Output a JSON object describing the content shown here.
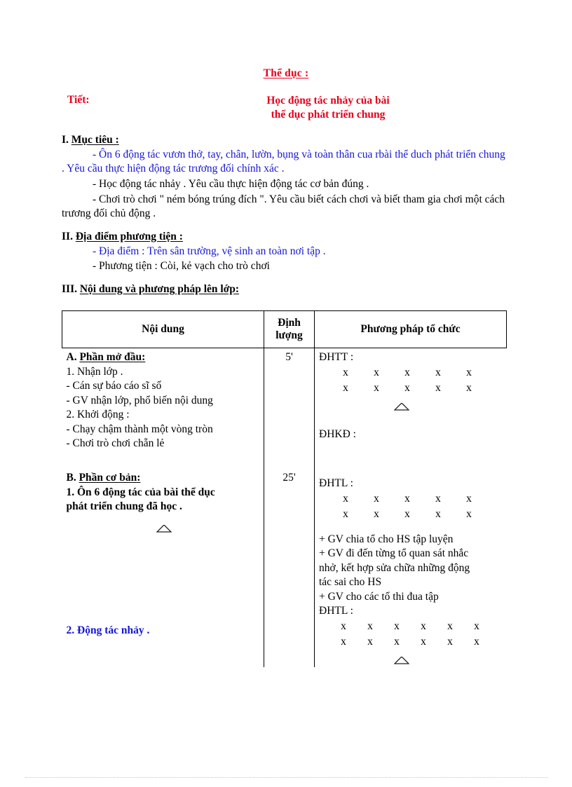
{
  "header": {
    "subject": "Thể dục :",
    "period_label": "Tiết:",
    "lesson_title_line1": "Học động tác nhảy của bài",
    "lesson_title_line2": "thể dục phát triển chung",
    "accent_color": "#e8001c",
    "blue_color": "#1616d8"
  },
  "sections": {
    "objectives": {
      "heading_num": "I. ",
      "heading": "Mục tiêu :",
      "lines": [
        {
          "color": "blue",
          "indent": true,
          "text": "- Ôn 6 động tác vươn thở, tay, chân, lườn, bụng và toàn thân cua rbài thể duch phát triển chung . Yêu cầu thực hiện động tác trương đối chính xác ."
        },
        {
          "color": "black",
          "indent": true,
          "text": "- Học động tác nhảy . Yêu cầu thực hiện động tác cơ bản đúng ."
        },
        {
          "color": "black",
          "indent": true,
          "text": "- Chơi trò chơi \" ném bóng trúng đích \". Yêu cầu biết cách chơi và biết tham gia chơi một cách trương đối chủ động ."
        }
      ]
    },
    "location": {
      "heading_num": "II. ",
      "heading": "Địa điểm phương tiện :",
      "lines": [
        {
          "color": "blue",
          "indent": true,
          "text": "- Địa điểm : Trên sân trường, vệ sinh an toàn nơi tập ."
        },
        {
          "color": "black",
          "indent": true,
          "text": "- Phương tiện : Còi, kẻ vạch cho trò chơi"
        }
      ]
    },
    "content_method": {
      "heading_num": "III. ",
      "heading": "Nội dung và phương pháp lên lớp:"
    }
  },
  "table": {
    "columns": [
      {
        "label": "Nội dung"
      },
      {
        "label_line1": "Định",
        "label_line2": "lượng"
      },
      {
        "label": "Phương pháp tổ chức"
      }
    ],
    "part_a": {
      "content": {
        "heading_prefix": "A. ",
        "heading": "Phần mở đầu:",
        "lines": [
          "1. Nhận lớp .",
          "- Cán sự báo cáo sĩ số",
          "- GV nhận lớp, phổ biến nội dung",
          "2. Khởi động :",
          "- Chạy chậm thành một vòng tròn",
          "- Chơi trò chơi chẵn lẻ"
        ]
      },
      "quantity": "5'",
      "method": {
        "formation1_label": "ĐHTT :",
        "formation1_row1": [
          "x",
          "x",
          "x",
          "x",
          "x"
        ],
        "formation1_row2": [
          "x",
          "x",
          "x",
          "x",
          "x"
        ],
        "formation2_label": "ĐHKĐ :"
      }
    },
    "part_b": {
      "content": {
        "heading_prefix": "B. ",
        "heading": "Phần cơ bản:",
        "item1_line1": "1. Ôn 6 động tác của bài thể dục",
        "item1_line2": "phát triển chung đã học .",
        "item2": "2. Động tác nhảy ."
      },
      "quantity": "25'",
      "method": {
        "formation1_label": "ĐHTL :",
        "formation1_row1": [
          "x",
          "x",
          "x",
          "x",
          "x"
        ],
        "formation1_row2": [
          "x",
          "x",
          "x",
          "x",
          "x"
        ],
        "notes": [
          "+ GV chia tổ cho HS tập luyện",
          "+ GV đi đến từng tổ quan sát nhắc",
          "nhở, kết hợp sửa chữa những động",
          "tác sai cho HS",
          "+ GV cho các tổ thi đua tập"
        ],
        "formation2_label": "ĐHTL :",
        "formation2_row1": [
          "x",
          "x",
          "x",
          "x",
          "x",
          "x"
        ],
        "formation2_row2": [
          "x",
          "x",
          "x",
          "x",
          "x",
          "x"
        ]
      }
    }
  }
}
